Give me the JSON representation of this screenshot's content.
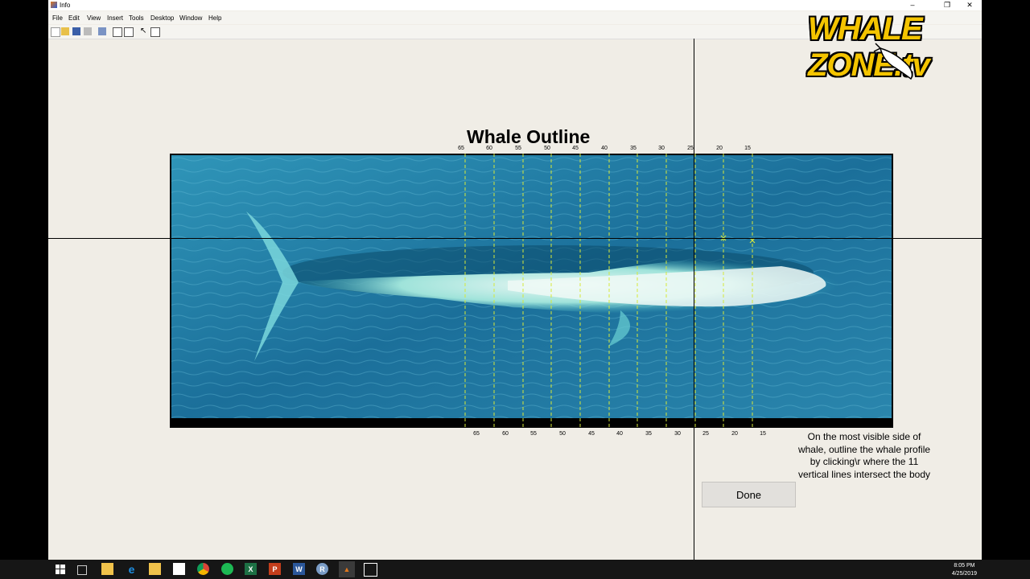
{
  "window": {
    "title": "Info",
    "menu": [
      "File",
      "Edit",
      "View",
      "Insert",
      "Tools",
      "Desktop",
      "Window",
      "Help"
    ],
    "controls": {
      "minimize": "–",
      "restore": "❐",
      "close": "✕"
    }
  },
  "figure": {
    "title": "Whale Outline",
    "top_labels": [
      "65",
      "60",
      "55",
      "50",
      "45",
      "40",
      "35",
      "30",
      "25",
      "20",
      "15"
    ],
    "bottom_labels": [
      "65",
      "60",
      "55",
      "50",
      "45",
      "40",
      "35",
      "30",
      "25",
      "20",
      "15"
    ],
    "instructions": "On the most visible side of whale, outline the whale profile by clicking\\r where the 11 vertical lines intersect the body",
    "done_label": "Done",
    "guide_line_color": "#d6e83a",
    "marker_color": "#d6e83a"
  },
  "logo": {
    "text": "WHALE ZONE.tv",
    "color": "#f4c400"
  },
  "taskbar": {
    "time": "8:05 PM",
    "date": "4/25/2019",
    "apps": [
      "start-icon",
      "task-view-icon",
      "store-icon",
      "edge-icon",
      "file-explorer-icon",
      "mail-icon",
      "chrome-icon",
      "spotify-icon",
      "excel-icon",
      "powerpoint-icon",
      "word-icon",
      "r-icon",
      "matlab-icon",
      "photos-icon"
    ]
  }
}
